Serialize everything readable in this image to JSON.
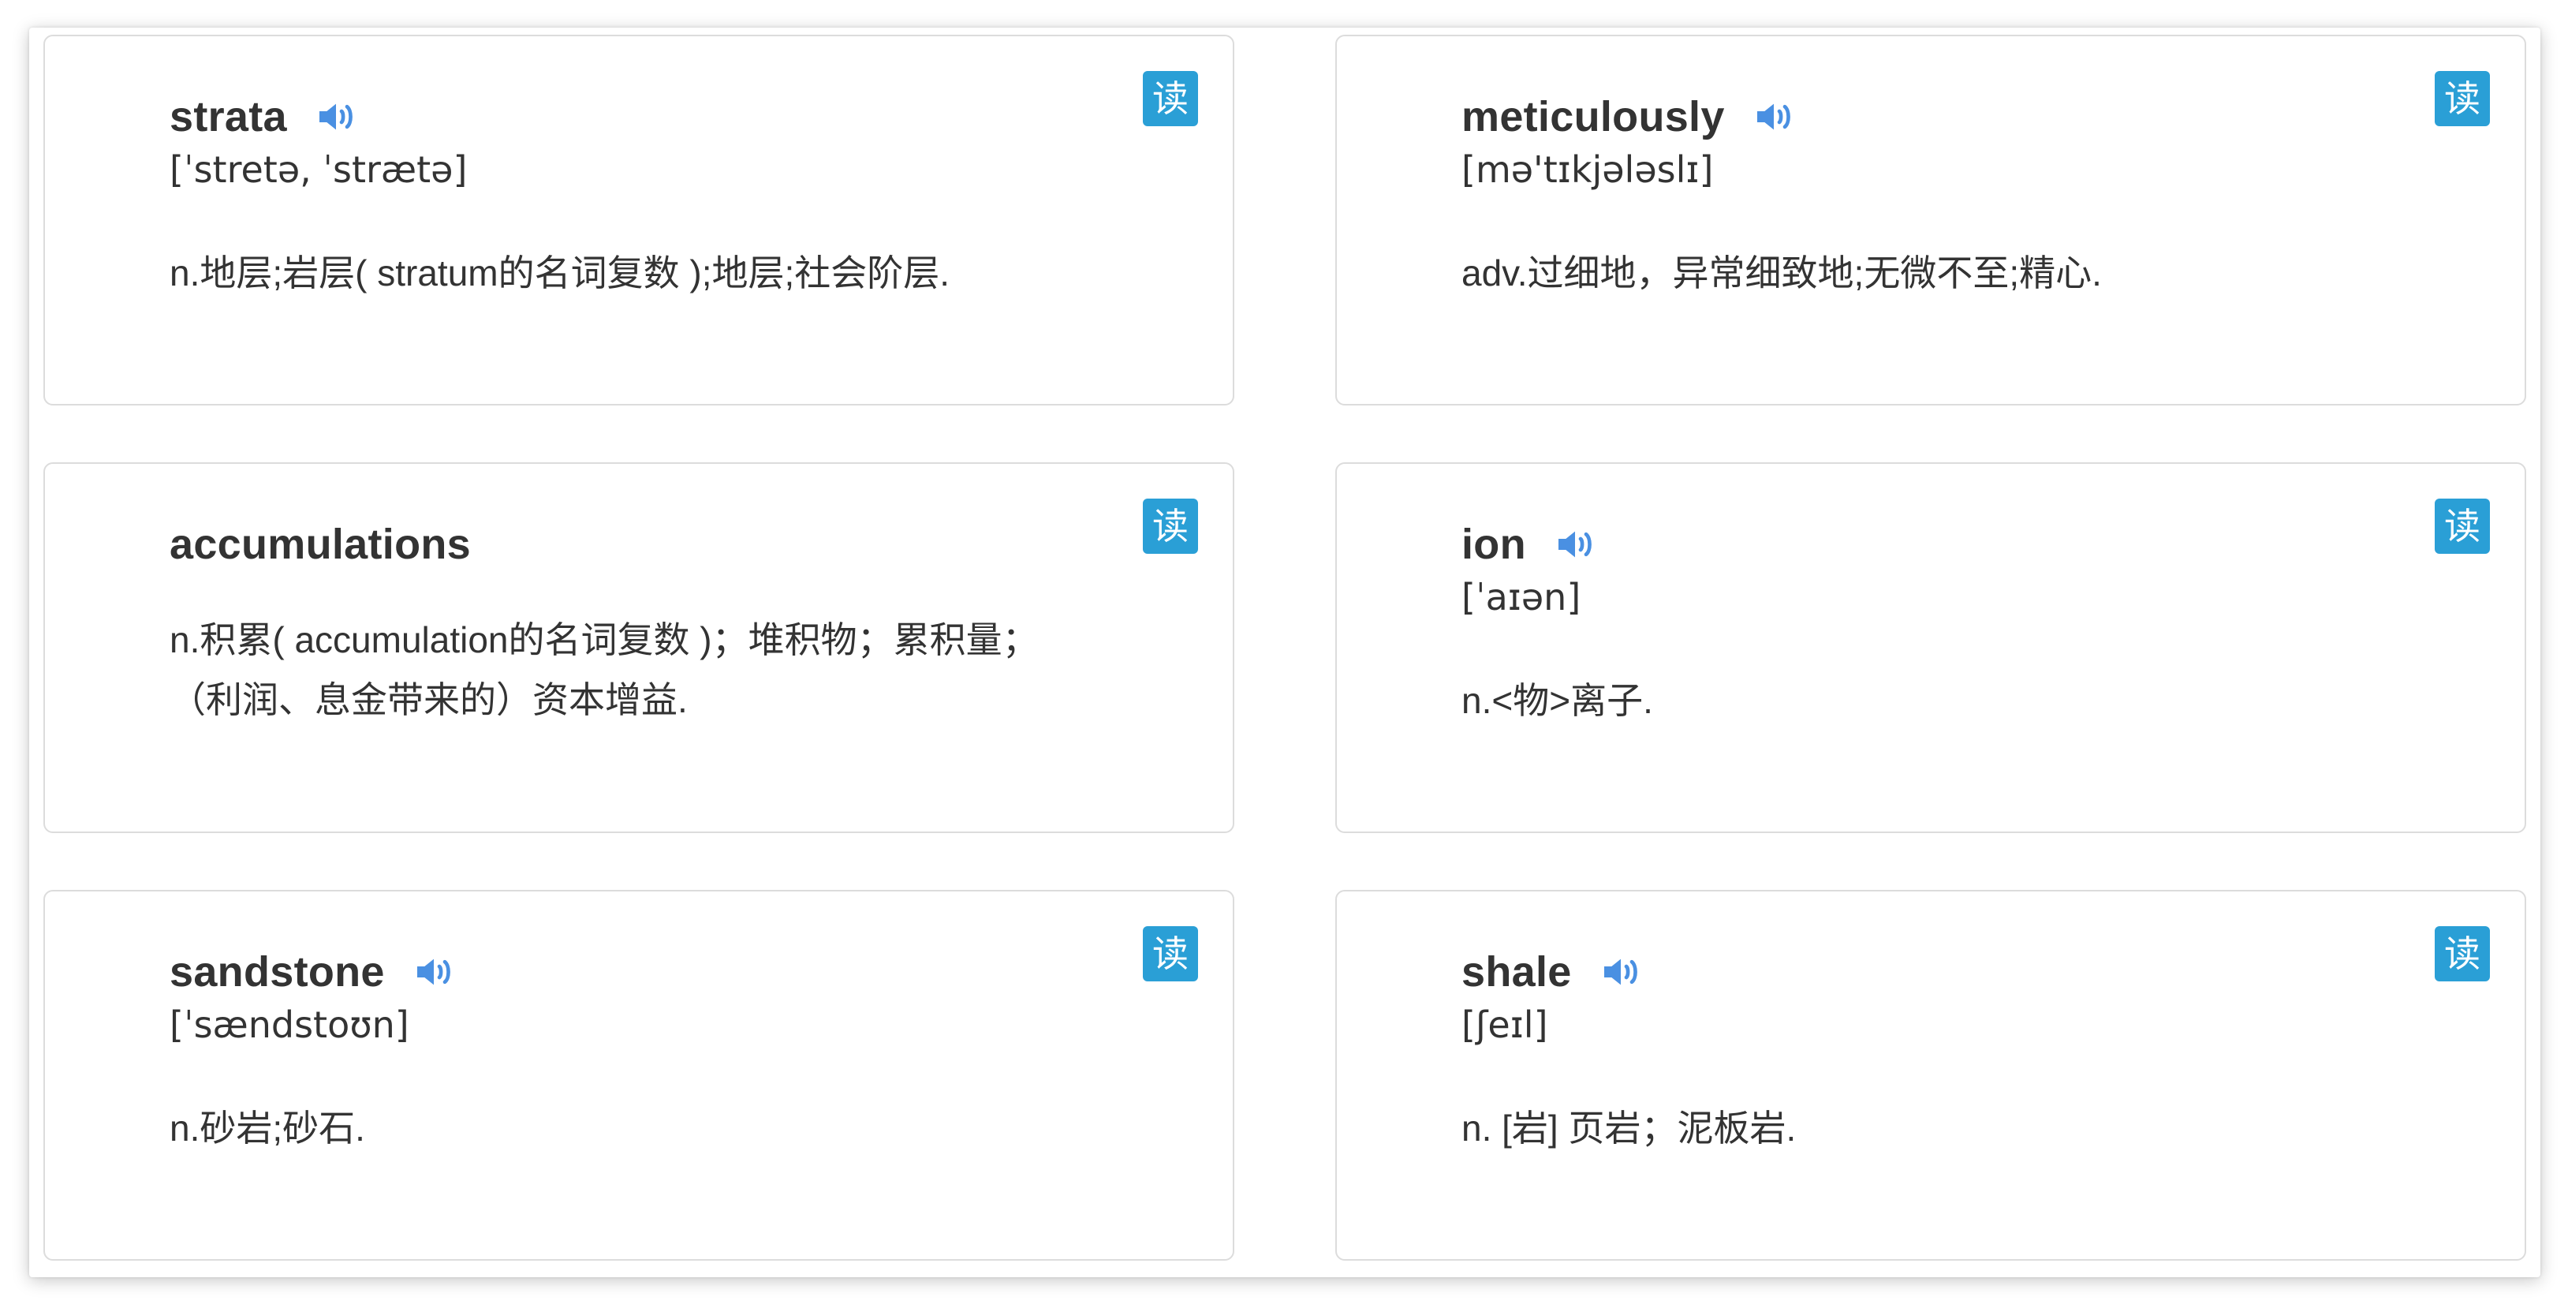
{
  "colors": {
    "accent": "#2a9fd6",
    "speaker": "#4a90e2",
    "text": "#333333",
    "card_border": "#dcdcdc"
  },
  "read_label": "读",
  "cards": [
    {
      "word": "strata",
      "phonetic": "[ˈstretə, ˈstrætə]",
      "definition": "n.地层;岩层( stratum的名词复数 );地层;社会阶层.",
      "has_speaker": true
    },
    {
      "word": "meticulously",
      "phonetic": "[mə'tɪkjələslɪ]",
      "definition": "adv.过细地，异常细致地;无微不至;精心.",
      "has_speaker": true
    },
    {
      "word": "accumulations",
      "phonetic": "",
      "definition": "n.积累( accumulation的名词复数 )；堆积物；累积量；（利润、息金带来的）资本增益.",
      "has_speaker": false
    },
    {
      "word": "ion",
      "phonetic": "[ˈaɪən]",
      "definition": "n.<物>离子.",
      "has_speaker": true
    },
    {
      "word": "sandstone",
      "phonetic": "[ˈsændstoʊn]",
      "definition": "n.砂岩;砂石.",
      "has_speaker": true
    },
    {
      "word": "shale",
      "phonetic": "[ʃeɪl]",
      "definition": "n. [岩] 页岩；泥板岩.",
      "has_speaker": true
    }
  ]
}
